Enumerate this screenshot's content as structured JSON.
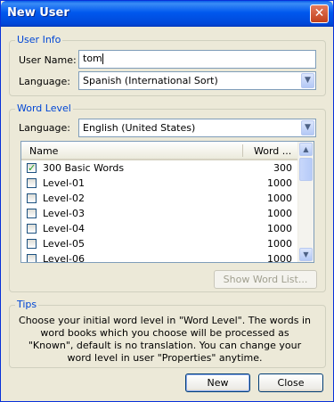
{
  "window": {
    "title": "New User"
  },
  "user_info": {
    "group_label": "User Info",
    "user_name_label": "User Name:",
    "user_name_value": "tom",
    "language_label": "Language:",
    "language_value": "Spanish (International Sort)"
  },
  "word_level": {
    "group_label": "Word Level",
    "language_label": "Language:",
    "language_value": "English (United States)",
    "columns": [
      "Name",
      "Word ..."
    ],
    "rows": [
      {
        "name": "300 Basic Words",
        "count": "300",
        "checked": true
      },
      {
        "name": "Level-01",
        "count": "1000",
        "checked": false
      },
      {
        "name": "Level-02",
        "count": "1000",
        "checked": false
      },
      {
        "name": "Level-03",
        "count": "1000",
        "checked": false
      },
      {
        "name": "Level-04",
        "count": "1000",
        "checked": false
      },
      {
        "name": "Level-05",
        "count": "1000",
        "checked": false
      },
      {
        "name": "Level-06",
        "count": "1000",
        "checked": false
      }
    ],
    "show_word_list_label": "Show Word List..."
  },
  "tips": {
    "group_label": "Tips",
    "text": "Choose your initial word level in \"Word Level\". The words in word books which you choose will be processed as \"Known\", default is no translation. You can change your word level in user \"Properties\" anytime."
  },
  "buttons": {
    "new_label": "New",
    "close_label": "Close"
  }
}
